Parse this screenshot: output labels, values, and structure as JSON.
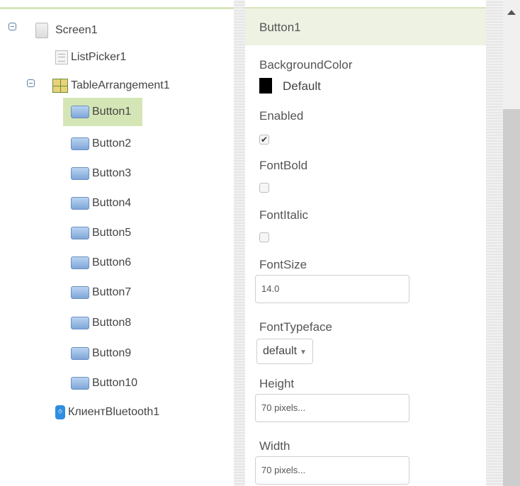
{
  "tree": {
    "screen": "Screen1",
    "listpicker": "ListPicker1",
    "table": "TableArrangement1",
    "buttons": [
      "Button1",
      "Button2",
      "Button3",
      "Button4",
      "Button5",
      "Button6",
      "Button7",
      "Button8",
      "Button9",
      "Button10"
    ],
    "bluetooth": "КлиентBluetooth1"
  },
  "props": {
    "header": "Button1",
    "background_color_label": "BackgroundColor",
    "background_color_value": "Default",
    "enabled_label": "Enabled",
    "enabled_checked": true,
    "fontbold_label": "FontBold",
    "fontbold_checked": false,
    "fontitalic_label": "FontItalic",
    "fontitalic_checked": false,
    "fontsize_label": "FontSize",
    "fontsize_value": "14.0",
    "fonttypeface_label": "FontTypeface",
    "fonttypeface_value": "default",
    "height_label": "Height",
    "height_value": "70 pixels...",
    "width_label": "Width",
    "width_value": "70 pixels..."
  },
  "colors": {
    "selected_bg": "#d4e6b5",
    "header_bg": "#edf2e3",
    "accent": "#d6e5b9"
  }
}
